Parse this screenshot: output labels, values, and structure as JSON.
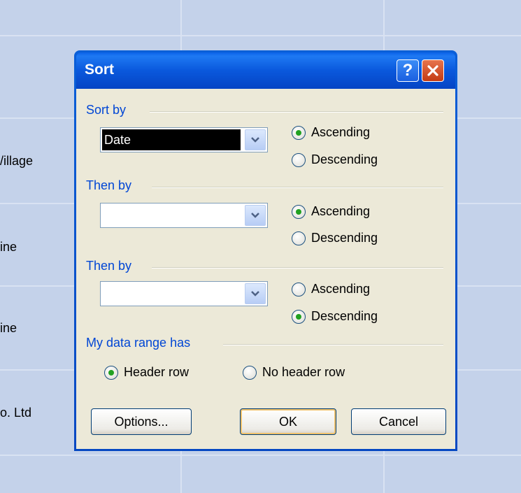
{
  "background": {
    "cells": [
      "/illage",
      "ine",
      "ine",
      "o. Ltd"
    ]
  },
  "dialog": {
    "title": "Sort",
    "help_icon": "?",
    "close_icon": "x",
    "sort_by": {
      "label": "Sort by",
      "value": "Date",
      "ascending_label": "Ascending",
      "descending_label": "Descending",
      "selected": "ascending"
    },
    "then_by_1": {
      "label": "Then by",
      "value": "",
      "ascending_label": "Ascending",
      "descending_label": "Descending",
      "selected": "ascending"
    },
    "then_by_2": {
      "label": "Then by",
      "value": "",
      "ascending_label": "Ascending",
      "descending_label": "Descending",
      "selected": "descending"
    },
    "data_range": {
      "label": "My data range has",
      "header_row_label": "Header row",
      "no_header_row_label": "No header row",
      "selected": "header_row"
    },
    "buttons": {
      "options": "Options...",
      "ok": "OK",
      "cancel": "Cancel"
    }
  }
}
